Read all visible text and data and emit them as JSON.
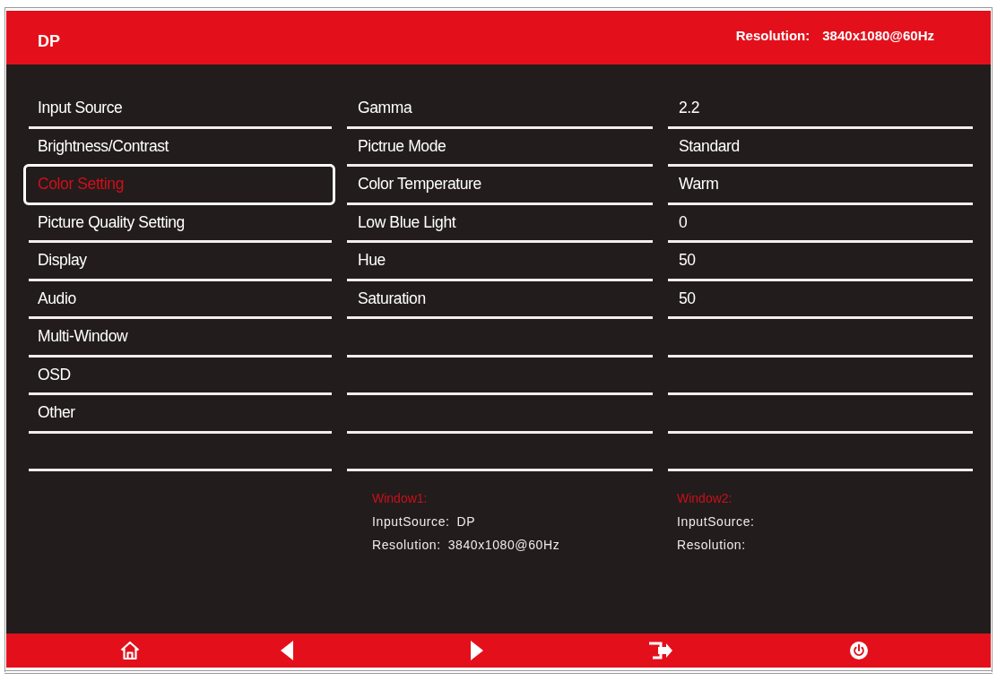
{
  "header": {
    "source": "DP",
    "resolution_label": "Resolution:",
    "resolution": "3840x1080@60Hz"
  },
  "menu": [
    {
      "label": "Input Source",
      "selected": false
    },
    {
      "label": "Brightness/Contrast",
      "selected": false
    },
    {
      "label": "Color Setting",
      "selected": true
    },
    {
      "label": "Picture Quality Setting",
      "selected": false
    },
    {
      "label": "Display",
      "selected": false
    },
    {
      "label": "Audio",
      "selected": false
    },
    {
      "label": "Multi-Window",
      "selected": false
    },
    {
      "label": "OSD",
      "selected": false
    },
    {
      "label": "Other",
      "selected": false
    }
  ],
  "settings": [
    {
      "name": "Gamma",
      "value": "2.2"
    },
    {
      "name": "Pictrue Mode",
      "value": "Standard"
    },
    {
      "name": "Color Temperature",
      "value": "Warm"
    },
    {
      "name": "Low Blue Light",
      "value": "0"
    },
    {
      "name": "Hue",
      "value": "50"
    },
    {
      "name": "Saturation",
      "value": "50"
    }
  ],
  "windows": [
    {
      "title": "Window1:",
      "fields": [
        {
          "label": "InputSource:",
          "value": "DP"
        },
        {
          "label": "Resolution:",
          "value": "3840x1080@60Hz"
        }
      ]
    },
    {
      "title": "Window2:",
      "fields": [
        {
          "label": "InputSource:"
        },
        {
          "label": "Resolution:"
        }
      ]
    }
  ],
  "footer": [
    {
      "kind": "home"
    },
    {
      "kind": "previous"
    },
    {
      "kind": "next"
    },
    {
      "kind": "exit"
    },
    {
      "kind": "power"
    }
  ]
}
